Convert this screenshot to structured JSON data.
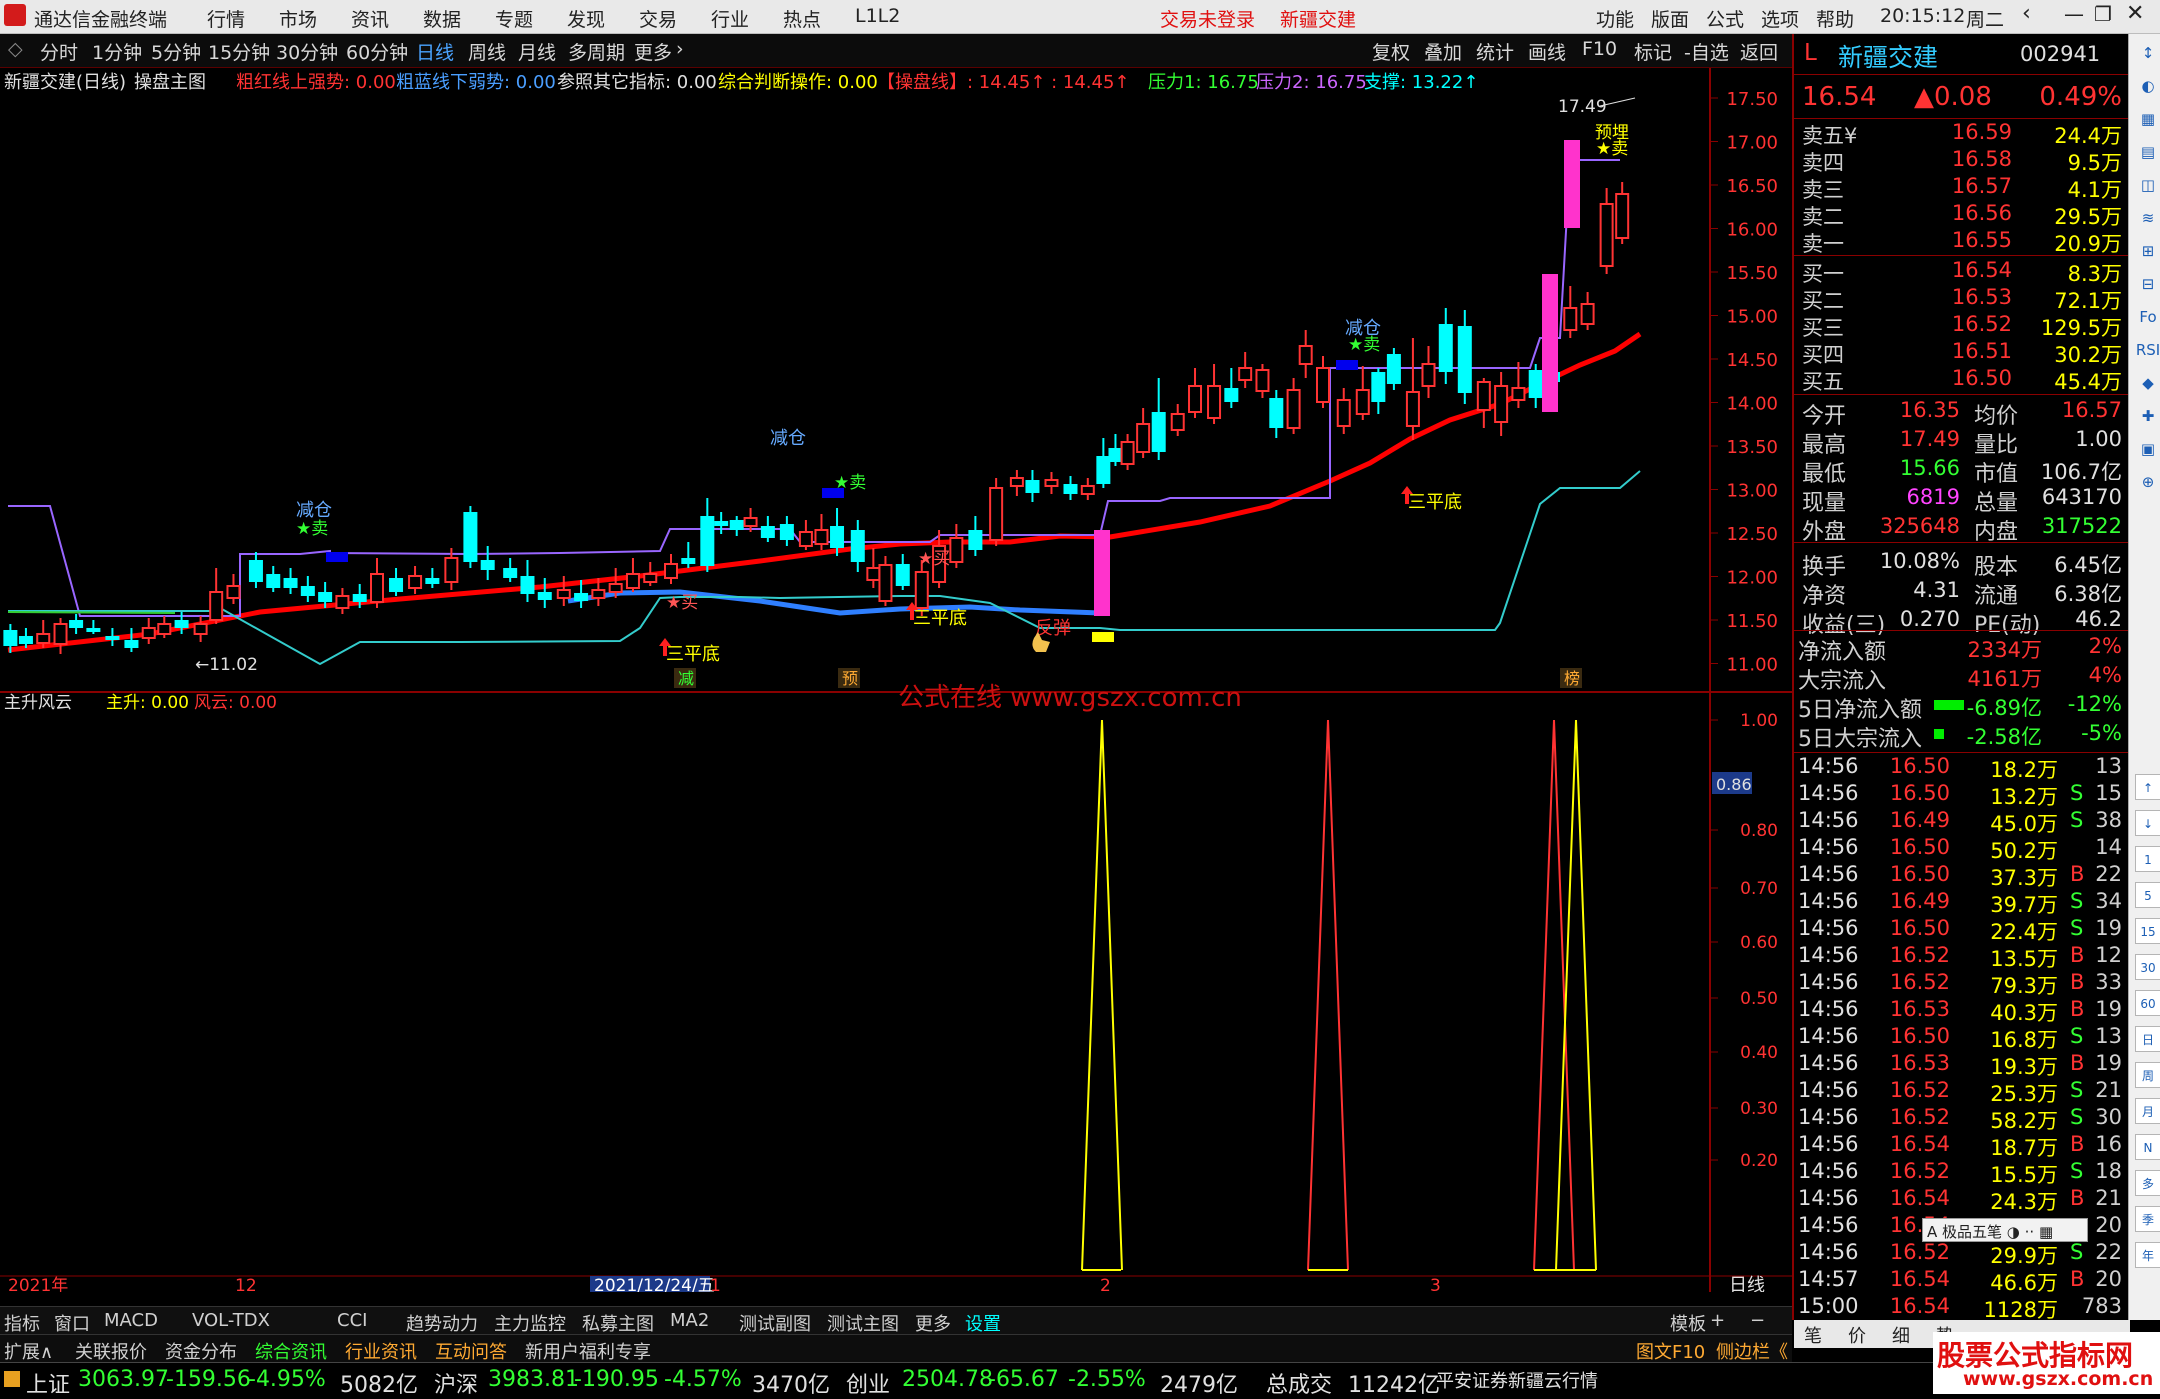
{
  "menubar": {
    "app": "通达信金融终端",
    "items": [
      "行情",
      "市场",
      "资讯",
      "数据",
      "专题",
      "发现",
      "交易",
      "行业",
      "热点",
      "L1L2"
    ],
    "status": [
      "交易未登录",
      "新疆交建"
    ],
    "right": [
      "功能",
      "版面",
      "公式",
      "选项",
      "帮助"
    ],
    "time": "20:15:12",
    "weekday": "周二"
  },
  "tfbar": {
    "items": [
      "分时",
      "1分钟",
      "5分钟",
      "15分钟",
      "30分钟",
      "60分钟",
      "日线",
      "周线",
      "月线",
      "多周期",
      "更多"
    ],
    "right": [
      "复权",
      "叠加",
      "统计",
      "画线",
      "F10",
      "标记",
      "-自选",
      "返回"
    ]
  },
  "chart": {
    "header": {
      "title": "新疆交建(日线)",
      "formula": "操盘主图",
      "ind1": "粗红线上强势: 0.00",
      "ind2": "粗蓝线下弱势: 0.00",
      "ind3": "参照其它指标: 0.00",
      "ind4": "综合判断操作: 0.00",
      "ind5": "【操盘线】: 14.45↑ : 14.45↑",
      "ind6": "压力1: 16.75",
      "ind7": "压力2: 16.75",
      "ind8": "支撑: 13.22↑"
    },
    "price_axis": [
      "17.50",
      "17.00",
      "16.50",
      "16.00",
      "15.50",
      "15.00",
      "14.50",
      "14.00",
      "13.50",
      "13.00",
      "12.50",
      "12.00",
      "11.50",
      "11.00"
    ],
    "markers": {
      "high": "17.49",
      "low": "←11.02"
    },
    "labels": {
      "jiancang": "减仓",
      "sell": "★卖",
      "buy": "★买",
      "sanpingdi": "三平底",
      "fantan": "反弹",
      "yubei": "预埋"
    },
    "flags": [
      "减",
      "预",
      "榜"
    ],
    "watermark": "公式在线  www.gszx.com.cn"
  },
  "sub": {
    "title": "主升风云",
    "ind1": "主升: 0.00",
    "ind2": "风云: 0.00",
    "axis": [
      "1.00",
      "0.80",
      "0.70",
      "0.60",
      "0.50",
      "0.40",
      "0.30",
      "0.20"
    ],
    "cur": "0.86"
  },
  "dates": [
    "2021年",
    "12",
    "2021/12/24/五",
    "1",
    "2",
    "3"
  ],
  "period_label": "日线",
  "tabs": [
    "指标",
    "窗口",
    "MACD",
    "VOL-TDX",
    "CCI",
    "趋势动力",
    "主力监控",
    "私募主图",
    "MA2",
    "测试副图",
    "测试主图",
    "更多",
    "设置"
  ],
  "tabs_right": [
    "模板",
    "+",
    "−"
  ],
  "info_tabs": [
    "扩展∧",
    "关联报价",
    "资金分布",
    "综合资讯",
    "行业资讯",
    "互动问答",
    "新用户福利专享"
  ],
  "info_right": [
    "图文F10",
    "侧边栏《"
  ],
  "index": {
    "sh": [
      "上证",
      "3063.97",
      "-159.56",
      "-4.95%",
      "5082亿"
    ],
    "hs": [
      "沪深",
      "3983.81",
      "-190.95",
      "-4.57%",
      "3470亿"
    ],
    "cy": [
      "创业",
      "2504.78",
      "-65.67",
      "-2.55%",
      "2479亿"
    ],
    "total": [
      "总成交",
      "11242亿"
    ],
    "broker": "平安证券新疆云行情"
  },
  "stock": {
    "prefix": "L",
    "name": "新疆交建",
    "code": "002941",
    "price": "16.54",
    "change": "▲0.08",
    "pct": "0.49%"
  },
  "order": {
    "sell": [
      [
        "卖五¥",
        "16.59",
        "24.4万"
      ],
      [
        "卖四",
        "16.58",
        "9.5万"
      ],
      [
        "卖三",
        "16.57",
        "4.1万"
      ],
      [
        "卖二",
        "16.56",
        "29.5万"
      ],
      [
        "卖一",
        "16.55",
        "20.9万"
      ]
    ],
    "buy": [
      [
        "买一",
        "16.54",
        "8.3万"
      ],
      [
        "买二",
        "16.53",
        "72.1万"
      ],
      [
        "买三",
        "16.52",
        "129.5万"
      ],
      [
        "买四",
        "16.51",
        "30.2万"
      ],
      [
        "买五",
        "16.50",
        "45.4万"
      ]
    ]
  },
  "stats": [
    [
      "今开",
      "16.35",
      "均价",
      "16.57"
    ],
    [
      "最高",
      "17.49",
      "量比",
      "1.00"
    ],
    [
      "最低",
      "15.66",
      "市值",
      "106.7亿"
    ],
    [
      "现量",
      "6819",
      "总量",
      "643170"
    ],
    [
      "外盘",
      "325648",
      "内盘",
      "317522"
    ],
    [
      "换手",
      "10.08%",
      "股本",
      "6.45亿"
    ],
    [
      "净资",
      "4.31",
      "流通",
      "6.38亿"
    ],
    [
      "收益(三)",
      "0.270",
      "PE(动)",
      "46.2"
    ]
  ],
  "flows": [
    [
      "净流入额",
      "2334万",
      "2%"
    ],
    [
      "大宗流入",
      "4161万",
      "4%"
    ],
    [
      "5日净流入额",
      "-6.89亿",
      "-12%"
    ],
    [
      "5日大宗流入",
      "-2.58亿",
      "-5%"
    ]
  ],
  "ticks": [
    [
      "14:56",
      "16.50",
      "18.2万",
      "",
      "13"
    ],
    [
      "14:56",
      "16.50",
      "13.2万",
      "S",
      "15"
    ],
    [
      "14:56",
      "16.49",
      "45.0万",
      "S",
      "38"
    ],
    [
      "14:56",
      "16.50",
      "50.2万",
      "",
      "14"
    ],
    [
      "14:56",
      "16.50",
      "37.3万",
      "B",
      "22"
    ],
    [
      "14:56",
      "16.49",
      "39.7万",
      "S",
      "34"
    ],
    [
      "14:56",
      "16.50",
      "22.4万",
      "S",
      "19"
    ],
    [
      "14:56",
      "16.52",
      "13.5万",
      "B",
      "12"
    ],
    [
      "14:56",
      "16.52",
      "79.3万",
      "B",
      "33"
    ],
    [
      "14:56",
      "16.53",
      "40.3万",
      "B",
      "19"
    ],
    [
      "14:56",
      "16.50",
      "16.8万",
      "S",
      "13"
    ],
    [
      "14:56",
      "16.53",
      "19.3万",
      "B",
      "19"
    ],
    [
      "14:56",
      "16.52",
      "25.3万",
      "S",
      "21"
    ],
    [
      "14:56",
      "16.52",
      "58.2万",
      "S",
      "30"
    ],
    [
      "14:56",
      "16.54",
      "18.7万",
      "B",
      "16"
    ],
    [
      "14:56",
      "16.52",
      "15.5万",
      "S",
      "18"
    ],
    [
      "14:56",
      "16.54",
      "24.3万",
      "B",
      "21"
    ],
    [
      "14:56",
      "16.54",
      "",
      "",
      "20"
    ],
    [
      "14:56",
      "16.52",
      "29.9万",
      "S",
      "22"
    ],
    [
      "14:57",
      "16.54",
      "46.6万",
      "B",
      "20"
    ],
    [
      "15:00",
      "16.54",
      "1128万",
      "",
      "783"
    ]
  ],
  "ime": "A 极品五笔 ◑ ·· ▦",
  "rtabs": [
    "笔",
    "价",
    "细",
    "势"
  ],
  "vtool": [
    "↑",
    "↓",
    "1",
    "5",
    "15",
    "30",
    "60",
    "日",
    "周",
    "月",
    "N",
    "多",
    "季",
    "年"
  ],
  "brand": "股票公式指标网",
  "brand_url": "www.gszx.com.cn",
  "colors": {
    "up": "#ff3333",
    "down": "#00ffff",
    "ma": "#ff0000",
    "ma_weak": "#2f7fff",
    "resist": "#9966ff",
    "support": "#33cccc",
    "surge": "#ff33cc",
    "yellow": "#ffff00"
  }
}
